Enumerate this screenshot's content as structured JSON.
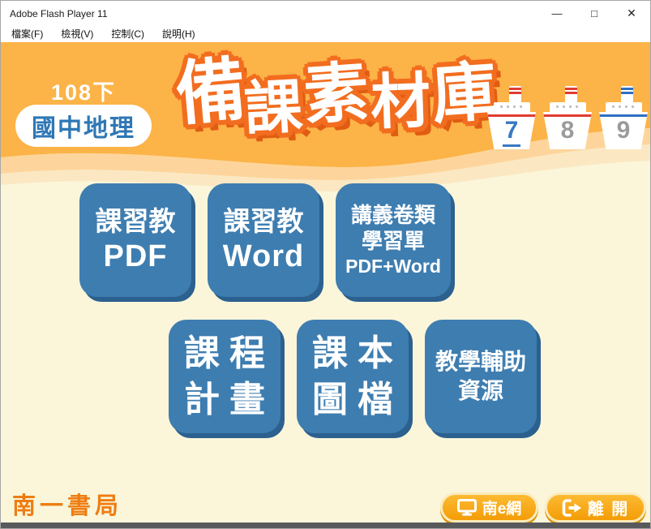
{
  "window": {
    "title": "Adobe Flash Player 11",
    "minimize": "—",
    "maximize": "□",
    "close": "✕"
  },
  "menu": {
    "items": [
      "檔案(F)",
      "檢視(V)",
      "控制(C)",
      "說明(H)"
    ]
  },
  "header": {
    "semester": "108下",
    "subject": "國中地理",
    "title": "備課素材庫",
    "title_chars": [
      "備",
      "課",
      "素",
      "材",
      "庫"
    ],
    "boats": [
      {
        "number": "7",
        "stripe": "red",
        "selected": true
      },
      {
        "number": "8",
        "stripe": "red",
        "selected": false
      },
      {
        "number": "9",
        "stripe": "blue",
        "selected": false
      }
    ]
  },
  "main": {
    "buttons": [
      {
        "lines": [
          "課習教",
          "PDF"
        ]
      },
      {
        "lines": [
          "課習教",
          "Word"
        ]
      },
      {
        "lines": [
          "講義卷類",
          "學習單",
          "PDF+Word"
        ]
      },
      {
        "lines": [
          "課程",
          "計畫"
        ]
      },
      {
        "lines": [
          "課本",
          "圖檔"
        ]
      },
      {
        "lines": [
          "教學輔助",
          "資源"
        ]
      }
    ]
  },
  "footer": {
    "logo": "南一書局",
    "portal_label": "南e網",
    "exit_label": "離 開"
  },
  "colors": {
    "header_orange": "#fcb347",
    "wave_light": "#fdd59c",
    "wave_pale": "#fbe8c3",
    "body_cream": "#fbf6da",
    "button_blue": "#3e7db0",
    "button_blue_shadow": "#2b608f",
    "title_outline_orange": "#f26d1f",
    "boat_red": "#e03c31",
    "boat_blue": "#2f6fc2",
    "number_selected_blue": "#3a79c3",
    "number_gray": "#9b9b9b",
    "footer_button_orange": "#f49d06",
    "logo_orange": "#ee7d12",
    "bottom_strip_gray": "#58595b"
  }
}
